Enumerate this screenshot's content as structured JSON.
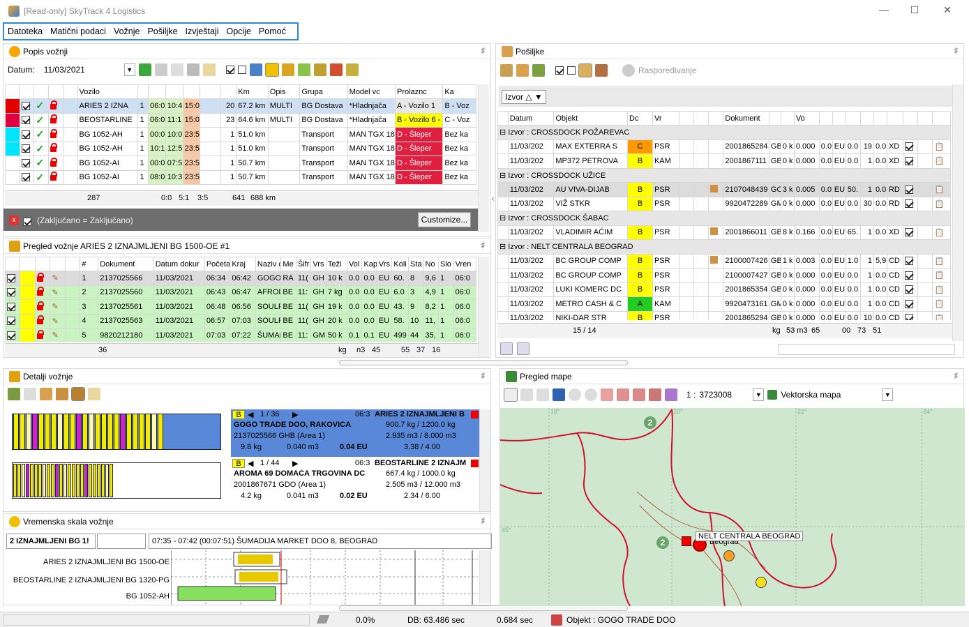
{
  "window": {
    "title": "[Read-only] SkyTrack 4 Logistics"
  },
  "menu": [
    "Datoteka",
    "Matični podaci",
    "Vožnje",
    "Pošiljke",
    "Izvještaji",
    "Opcije",
    "Pomoć"
  ],
  "trips": {
    "title": "Popis vožnji",
    "date_label": "Datum:",
    "date_value": "11/03/2021",
    "headers": [
      "Vozilo",
      "Km",
      "Opis",
      "Grupa",
      "Model vc",
      "Prolaznc",
      "Ka"
    ],
    "rows": [
      {
        "vehicle": "ARIES 2 IZNA",
        "n": "1",
        "t1": "06:0",
        "t2": "10:4",
        "t3": "15:0",
        "cnt": "20",
        "km": "67.2 km",
        "desc": "MULTI",
        "group": "BG Dostava",
        "model": "*Hladnjača",
        "pass": "A - Vozilo 1",
        "ka": "B - Voz",
        "color": "#e00000"
      },
      {
        "vehicle": "BEOSTARLINE",
        "n": "1",
        "t1": "06:0",
        "t2": "11:1",
        "t3": "15:0",
        "cnt": "23",
        "km": "64.6 km",
        "desc": "MULTI",
        "group": "BG Dostava",
        "model": "*Hladnjača",
        "pass": "B - Vozilo 6 -",
        "ka": "C - Voz",
        "color": "#e00040"
      },
      {
        "vehicle": "BG 1052-AH",
        "n": "1",
        "t1": "00:0",
        "t2": "10:0",
        "t3": "23:5",
        "cnt": "1",
        "km": "51.0 km",
        "desc": "",
        "group": "Transport",
        "model": "MAN TGX 18",
        "pass": "D - Šleper",
        "ka": "Bez ka",
        "color": "#00e5ff"
      },
      {
        "vehicle": "BG 1052-AH",
        "n": "1",
        "t1": "10:1",
        "t2": "12:5",
        "t3": "23:5",
        "cnt": "1",
        "km": "51.0 km",
        "desc": "",
        "group": "Transport",
        "model": "MAN TGX 18",
        "pass": "D - Šleper",
        "ka": "Bez ka",
        "color": "#00e5ff"
      },
      {
        "vehicle": "BG 1052-AI",
        "n": "1",
        "t1": "00:0",
        "t2": "07:5",
        "t3": "23:5",
        "cnt": "1",
        "km": "50.7 km",
        "desc": "",
        "group": "Transport",
        "model": "MAN TGX 18",
        "pass": "D - Šleper",
        "ka": "Bez ka",
        "color": "#ffffff"
      },
      {
        "vehicle": "BG 1052-AI",
        "n": "1",
        "t1": "08:0",
        "t2": "10:3",
        "t3": "23:5",
        "cnt": "1",
        "km": "50.7 km",
        "desc": "",
        "group": "Transport",
        "model": "MAN TGX 18",
        "pass": "D - Šleper",
        "ka": "Bez ka",
        "color": "#ffffff"
      }
    ],
    "footer": {
      "count": "287",
      "a": "0:0",
      "b": "5:1",
      "c": "3:5",
      "d": "641",
      "km": "688 km"
    },
    "filter_text": "(Zaključano = Zaključano)",
    "customize": "Customize..."
  },
  "trip_detail": {
    "title": "Pregled vožnje ARIES 2 IZNAJMLJENI BG 1500-OE #1",
    "headers": [
      "#",
      "Dokument",
      "Datum dokur",
      "Početak",
      "Kraj",
      "Naziv c",
      "Me",
      "Šifr",
      "Vrs",
      "Teži",
      "Vol",
      "Kap",
      "Vrs",
      "Koli",
      "Sta",
      "No",
      "Slo",
      "Vren"
    ],
    "rows": [
      [
        "1",
        "2137025566",
        "11/03/2021",
        "06:34",
        "06:42",
        "GOGO",
        "RA",
        "11(",
        "GH",
        "10 k",
        "0.0",
        "0.0",
        "EU",
        "60.",
        "8",
        "9,6",
        "1",
        "06:0"
      ],
      [
        "2",
        "2137025560",
        "11/03/2021",
        "06:43",
        "06:47",
        "AFROD",
        "BE",
        "11:",
        "GH",
        "7 kg",
        "0.0",
        "0.0",
        "EU",
        "6.0",
        "3",
        "4,9",
        "1",
        "06:0"
      ],
      [
        "3",
        "2137025561",
        "11/03/2021",
        "06:48",
        "06:56",
        "SOULF",
        "BE",
        "11(",
        "GH",
        "19 k",
        "0.0",
        "0.0",
        "EU",
        "43.",
        "9",
        "8,2",
        "1",
        "06:0"
      ],
      [
        "4",
        "2137025563",
        "11/03/2021",
        "06:57",
        "07:03",
        "SOULF",
        "BE",
        "11(",
        "GH",
        "20 k",
        "0.0",
        "0.0",
        "EU",
        "58.",
        "10",
        "11,",
        "1",
        "06:0"
      ],
      [
        "5",
        "9820212180",
        "11/03/2021",
        "07:03",
        "07:22",
        "ŠUMAD",
        "BE",
        "11:",
        "GM",
        "50 k",
        "0.1",
        "0.1",
        "EU",
        "499",
        "44",
        "35,",
        "1",
        "06:0"
      ]
    ],
    "footer": {
      "count": "36",
      "kg": "kg",
      "m3": "n3",
      "a": "45",
      "b": "55",
      "c": "37",
      "d": "16"
    }
  },
  "shipments": {
    "title": "Pošiljke",
    "schedule": "Raspoređivanje",
    "group_by": "Izvor",
    "headers": [
      "Datum",
      "Objekt",
      "Dc",
      "Vr",
      "Dokument",
      "Vo"
    ],
    "groups": [
      {
        "name": "Izvor : CROSSDOCK POŽAREVAC",
        "rows": [
          {
            "date": "11/03/202",
            "obj": "MAX EXTERRA S",
            "cls": "C",
            "clr": "#ff9900",
            "type": "PSR",
            "doc": "2001865284",
            "c1": "GB",
            "c2": "0 k",
            "vol": "0.000",
            "c3": "0.0",
            "cur": "EU",
            "v": "0.0",
            "n": "19",
            "m": "0.0",
            "x": "XD"
          },
          {
            "date": "11/03/202",
            "obj": "MP372 PETROVA",
            "cls": "B",
            "clr": "#ffff00",
            "type": "KAM",
            "doc": "2001867111",
            "c1": "GB",
            "c2": "0 k",
            "vol": "0.000",
            "c3": "0.0",
            "cur": "EU",
            "v": "0.0",
            "n": "1",
            "m": "0.0",
            "x": "XD"
          }
        ]
      },
      {
        "name": "Izvor : CROSSDOCK UŽICE",
        "rows": [
          {
            "date": "11/03/202",
            "obj": "AU VIVA-DIJAB",
            "cls": "B",
            "clr": "#ffff00",
            "type": "PSR",
            "doc": "2107048439",
            "c1": "GO",
            "c2": "3 k",
            "vol": "0.005",
            "c3": "0.0",
            "cur": "EU",
            "v": "50.",
            "n": "1",
            "m": "0.0",
            "x": "RD"
          },
          {
            "date": "11/03/202",
            "obj": "VIŽ STKR",
            "cls": "B",
            "clr": "#ffff00",
            "type": "PSR",
            "doc": "9920472289",
            "c1": "GM",
            "c2": "0 k",
            "vol": "0.000",
            "c3": "0.0",
            "cur": "EU",
            "v": "0.0",
            "n": "30",
            "m": "0.0",
            "x": "RD"
          }
        ]
      },
      {
        "name": "Izvor : CROSSDOCK ŠABAC",
        "rows": [
          {
            "date": "11/03/202",
            "obj": "VLADIMIR AĆIM",
            "cls": "B",
            "clr": "#ffff00",
            "type": "PSR",
            "doc": "2001866011",
            "c1": "GB",
            "c2": "8 k",
            "vol": "0.166",
            "c3": "0.0",
            "cur": "EU",
            "v": "65.",
            "n": "1",
            "m": "0.0",
            "x": "XD"
          }
        ]
      },
      {
        "name": "Izvor : NELT CENTRALA BEOGRAD",
        "rows": [
          {
            "date": "11/03/202",
            "obj": "BC GROUP COMP",
            "cls": "B",
            "clr": "#ffff00",
            "type": "PSR",
            "doc": "2100007426",
            "c1": "GB",
            "c2": "1 k",
            "vol": "0.003",
            "c3": "0.0",
            "cur": "EU",
            "v": "1.0",
            "n": "1",
            "m": "5,9",
            "x": "CD"
          },
          {
            "date": "11/03/202",
            "obj": "BC GROUP COMP",
            "cls": "B",
            "clr": "#ffff00",
            "type": "PSR",
            "doc": "2100007427",
            "c1": "GB",
            "c2": "0 k",
            "vol": "0.000",
            "c3": "0.0",
            "cur": "EU",
            "v": "0.0",
            "n": "1",
            "m": "0.0",
            "x": "CD"
          },
          {
            "date": "11/03/202",
            "obj": "LUKI KOMERC DC",
            "cls": "B",
            "clr": "#ffff00",
            "type": "PSR",
            "doc": "2001865354",
            "c1": "GB",
            "c2": "0 k",
            "vol": "0.000",
            "c3": "0.0",
            "cur": "EU",
            "v": "0.0",
            "n": "1",
            "m": "0.0",
            "x": "CD"
          },
          {
            "date": "11/03/202",
            "obj": "METRO CASH & C",
            "cls": "A",
            "clr": "#22cc22",
            "type": "KAM",
            "doc": "9920473161",
            "c1": "GM",
            "c2": "0 k",
            "vol": "0.000",
            "c3": "0.0",
            "cur": "EU",
            "v": "0.0",
            "n": "1",
            "m": "0.0",
            "x": "CD"
          },
          {
            "date": "11/03/202",
            "obj": "NIKI-DAR STR",
            "cls": "B",
            "clr": "#ffff00",
            "type": "PSR",
            "doc": "2001865294",
            "c1": "GB",
            "c2": "0 k",
            "vol": "0.000",
            "c3": "0.0",
            "cur": "EU",
            "v": "0.0",
            "n": "10",
            "m": "0.0",
            "x": "CD"
          }
        ]
      }
    ],
    "footer": {
      "count": "15 / 14",
      "kg": "kg",
      "m3": "53 m3",
      "a": "65",
      "b": "00",
      "c": "73",
      "d": "51"
    }
  },
  "trip_details": {
    "title": "Detalji vožnje",
    "cards": [
      {
        "cls": "B",
        "nav": "1 / 36",
        "time": "06:3",
        "vehicle": "ARIES 2 IZNAJMLJENI B",
        "customer": "GOGO TRADE DOO, RAKOVICA",
        "doc": "2137025566 GHB (Area 1)",
        "kg": "9.8 kg",
        "m3": "0.040 m3",
        "eur": "0.04 EU",
        "load_kg": "900.7 kg / 1200.0 kg",
        "load_m3": "2.935 m3 / 8.000 m3",
        "load_p": "3.38 / 4.00"
      },
      {
        "cls": "B",
        "nav": "1 / 44",
        "time": "06:3",
        "vehicle": "BEOSTARLINE 2 IZNAJM",
        "customer": "AROMA 69 DOMAĆA TRGOVINA DC",
        "doc": "2001867671 GDO (Area 1)",
        "kg": "4.2 kg",
        "m3": "0.041 m3",
        "eur": "0.02 EU",
        "load_kg": "667.4 kg / 1000.0 kg",
        "load_m3": "2.505 m3 / 12.000 m3",
        "load_p": "2.34 / 6.00"
      }
    ]
  },
  "timeline": {
    "title": "Vremenska skala vožnje",
    "field1": "2 IZNAJMLJENI BG 1!",
    "field3": "07:35 - 07:42 (00:07:51)  ŠUMADIJA MARKET DOO 8, BEOGRAD",
    "rows": [
      "ARIES 2 IZNAJMLJENI BG 1500-OE",
      "BEOSTARLINE 2 IZNAJMLJENI BG 1320-PG",
      "BG 1052-AH"
    ]
  },
  "map": {
    "title": "Pregled mape",
    "scale_label": "1 :",
    "scale": "3723008",
    "map_type": "Vektorska mapa",
    "grid": [
      "18°",
      "20°",
      "22°",
      "24°",
      "45°"
    ],
    "label": "NELT CENTRALA BEOGRAD",
    "city": "Beograd",
    "cluster1": "2",
    "cluster2": "2"
  },
  "status": {
    "progress": "0.0%",
    "db": "DB:  63.486 sec",
    "time": "0.684 sec",
    "object": "Objekt : GOGO TRADE DOO"
  }
}
